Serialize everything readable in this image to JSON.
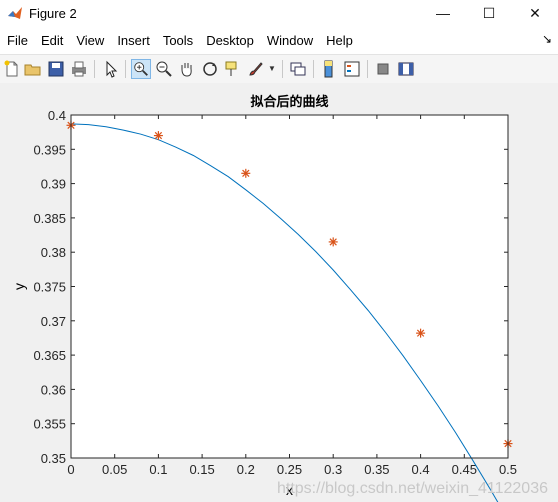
{
  "window": {
    "title": "Figure 2",
    "controls": {
      "minimize": "—",
      "maximize": "☐",
      "close": "✕"
    }
  },
  "menu": {
    "items": [
      "File",
      "Edit",
      "View",
      "Insert",
      "Tools",
      "Desktop",
      "Window",
      "Help"
    ],
    "overflow": "↘"
  },
  "toolbar": {
    "icons": [
      "new-figure-icon",
      "open-file-icon",
      "save-icon",
      "print-icon",
      "pointer-icon",
      "zoom-in-icon",
      "zoom-out-icon",
      "pan-hand-icon",
      "rotate-3d-icon",
      "data-cursor-icon",
      "brush-icon",
      "link-plot-icon",
      "colorbar-icon",
      "legend-icon",
      "hide-plot-tools-icon",
      "show-plot-tools-icon"
    ]
  },
  "colors": {
    "curve": "#0072bd",
    "markers": "#d95319",
    "axes_bg": "#ffffff",
    "figure_bg": "#f0f0f0"
  },
  "watermark": "https://blog.csdn.net/weixin_41122036",
  "chart_data": {
    "type": "line",
    "title": "拟合后的曲线",
    "xlabel": "x",
    "ylabel": "y",
    "xlim": [
      0,
      0.5
    ],
    "ylim": [
      0.35,
      0.4
    ],
    "xticks": [
      "0",
      "0.05",
      "0.1",
      "0.15",
      "0.2",
      "0.25",
      "0.3",
      "0.35",
      "0.4",
      "0.45",
      "0.5"
    ],
    "yticks": [
      "0.35",
      "0.355",
      "0.36",
      "0.365",
      "0.37",
      "0.375",
      "0.38",
      "0.385",
      "0.39",
      "0.395",
      "0.4"
    ],
    "grid": false,
    "series": [
      {
        "style": "line",
        "x": [
          0,
          0.02,
          0.04,
          0.06,
          0.08,
          0.1,
          0.12,
          0.14,
          0.16,
          0.18,
          0.2,
          0.22,
          0.24,
          0.26,
          0.28,
          0.3,
          0.32,
          0.34,
          0.36,
          0.38,
          0.4,
          0.42,
          0.44,
          0.46,
          0.48,
          0.5
        ],
        "y": [
          0.3987,
          0.3986,
          0.3983,
          0.3978,
          0.3972,
          0.3964,
          0.3953,
          0.3941,
          0.3926,
          0.391,
          0.3891,
          0.3871,
          0.3849,
          0.3826,
          0.3801,
          0.3774,
          0.3745,
          0.3715,
          0.3683,
          0.3649,
          0.3613,
          0.3576,
          0.3537,
          0.3496,
          0.3454,
          0.341
        ]
      },
      {
        "style": "markers",
        "marker": "*",
        "x": [
          0,
          0.1,
          0.2,
          0.3,
          0.4,
          0.5
        ],
        "y": [
          0.3985,
          0.397,
          0.3915,
          0.3815,
          0.3682,
          0.3521
        ]
      }
    ]
  }
}
